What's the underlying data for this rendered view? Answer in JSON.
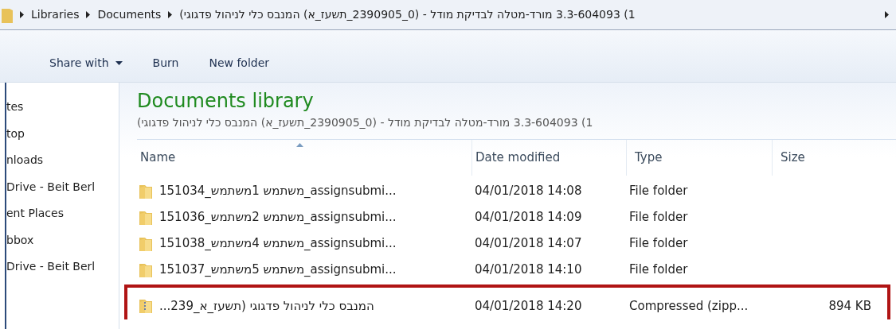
{
  "breadcrumb": {
    "segments": [
      "Libraries",
      "Documents",
      "1) 3.3-604093 מורד-מטלה לבדיקת מודל - (0_2390905_תשעז_א) המנבס כלי לניהול פדגוגי)"
    ]
  },
  "toolbar": {
    "items": [
      {
        "label": "Share with",
        "dropdown": true
      },
      {
        "label": "Burn",
        "dropdown": false
      },
      {
        "label": "New folder",
        "dropdown": false
      }
    ]
  },
  "sidebar": {
    "items": [
      "tes",
      "top",
      "nloads",
      "Drive - Beit Berl",
      "ent Places",
      "bbox",
      "Drive - Beit Berl"
    ]
  },
  "library": {
    "title": "Documents library",
    "subtitle": "1) 3.3-604093 מורד-מטלה לבדיקת מודל - (0_2390905_תשעז_א) המנבס כלי לניהול פדגוגי)"
  },
  "table": {
    "columns": [
      "Name",
      "Date modified",
      "Type",
      "Size"
    ],
    "rows": [
      {
        "kind": "folder",
        "name": "151034_משתמש 1משתמש_assignsubmi...",
        "date": "04/01/2018 14:08",
        "type": "File folder",
        "size": "",
        "highlighted": false
      },
      {
        "kind": "folder",
        "name": "151036_משתמש 2משתמש_assignsubmi...",
        "date": "04/01/2018 14:09",
        "type": "File folder",
        "size": "",
        "highlighted": false
      },
      {
        "kind": "folder",
        "name": "151038_משתמש 4משתמש_assignsubmi...",
        "date": "04/01/2018 14:07",
        "type": "File folder",
        "size": "",
        "highlighted": false
      },
      {
        "kind": "folder",
        "name": "151037_משתמש 5משתמש_assignsubmi...",
        "date": "04/01/2018 14:10",
        "type": "File folder",
        "size": "",
        "highlighted": false
      },
      {
        "kind": "zip",
        "name": "...המנבס כלי לניהול פדגוגי (תשעז_א_239",
        "date": "04/01/2018 14:20",
        "type": "Compressed (zipp...",
        "size": "894 KB",
        "highlighted": true
      }
    ]
  }
}
